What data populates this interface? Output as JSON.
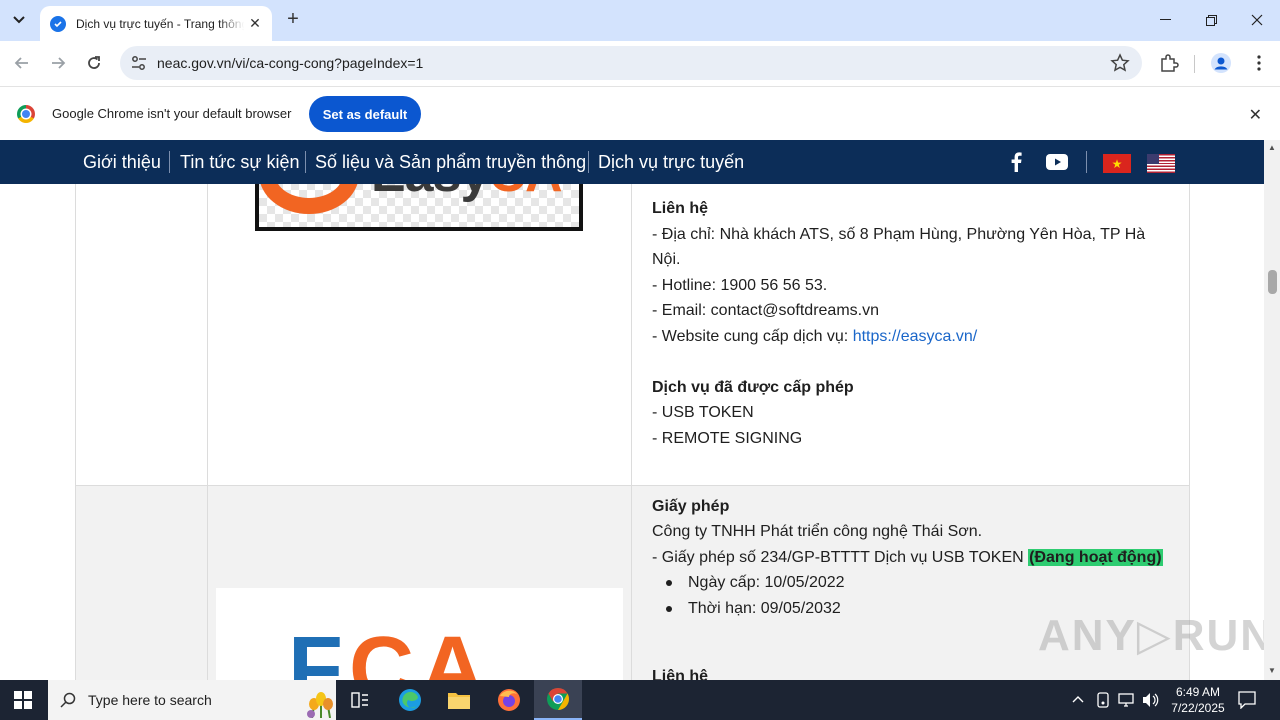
{
  "browser": {
    "tab": {
      "title": "Dịch vụ trực tuyến - Trang thông tin"
    },
    "url": "neac.gov.vn/vi/ca-cong-cong?pageIndex=1",
    "infobar": {
      "message": "Google Chrome isn't your default browser",
      "button": "Set as default"
    }
  },
  "site_nav": {
    "items": [
      "Giới thiệu",
      "Tin tức sự kiện",
      "Số liệu và Sản phẩm truyền thông",
      "Dịch vụ trực tuyến"
    ]
  },
  "logos": {
    "easyca": {
      "text_a": "Easy",
      "text_b": "CA"
    },
    "fca": {
      "text_a": "F",
      "text_b": "CA"
    }
  },
  "entry1": {
    "contact_heading": "Liên hệ",
    "address_line1": "- Địa chỉ: Nhà khách ATS, số 8 Phạm Hùng, Phường Yên Hòa, TP Hà",
    "address_line2": "Nội.",
    "hotline": "- Hotline: 1900 56 56 53.",
    "email": "- Email: contact@softdreams.vn",
    "website_label": "- Website cung cấp dịch vụ: ",
    "website_url": "https://easyca.vn/",
    "services_heading": "Dịch vụ đã được cấp phép",
    "service1": "- USB TOKEN",
    "service2": "- REMOTE SIGNING"
  },
  "entry2": {
    "license_heading": "Giấy phép",
    "company": "Công ty TNHH Phát triển công nghệ Thái Sơn.",
    "license_text": "- Giấy phép số 234/GP-BTTTT Dịch vụ USB TOKEN ",
    "status": "(Đang hoạt động)",
    "issue_date": "Ngày cấp: 10/05/2022",
    "expiry": "Thời hạn: 09/05/2032",
    "contact_heading": "Liên hệ"
  },
  "watermark": "ANY▷RUN",
  "taskbar": {
    "search_placeholder": "Type here to search",
    "time": "6:49 AM",
    "date": "7/22/2025"
  },
  "colors": {
    "nav_bg": "#0c2d58",
    "accent": "#0b57d0",
    "status_green": "#2ecc71",
    "link": "#1a66c9"
  }
}
